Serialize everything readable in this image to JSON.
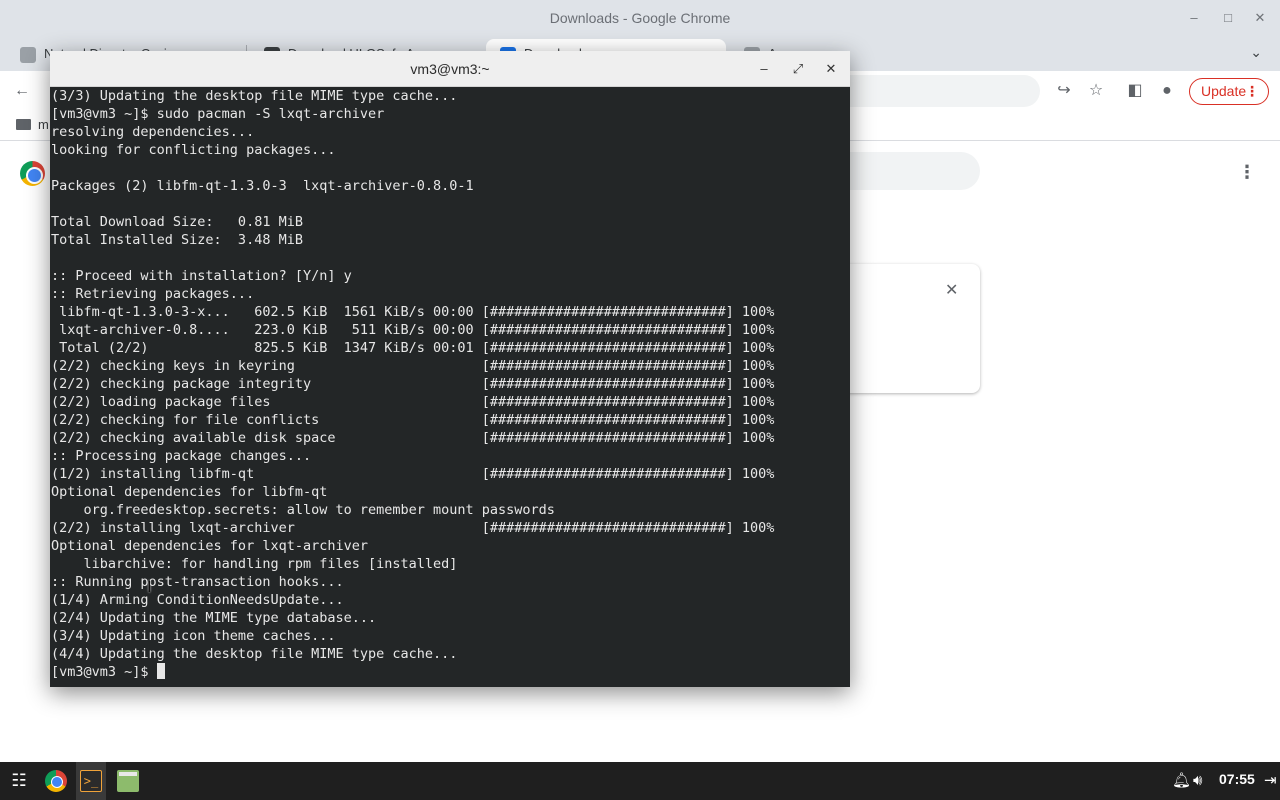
{
  "chrome": {
    "window_title": "Downloads - Google Chrome",
    "tabs": [
      {
        "label": "Natural Disaster Casi..."
      },
      {
        "label": "Download ULGSafe A..."
      },
      {
        "label": "Downloads"
      },
      {
        "label": "A"
      }
    ],
    "update_label": "Update",
    "bookmark_label": "m"
  },
  "terminal": {
    "title": "vm3@vm3:~",
    "lines": [
      "(3/3) Updating the desktop file MIME type cache...",
      "[vm3@vm3 ~]$ sudo pacman -S lxqt-archiver",
      "resolving dependencies...",
      "looking for conflicting packages...",
      "",
      "Packages (2) libfm-qt-1.3.0-3  lxqt-archiver-0.8.0-1",
      "",
      "Total Download Size:   0.81 MiB",
      "Total Installed Size:  3.48 MiB",
      "",
      ":: Proceed with installation? [Y/n] y",
      ":: Retrieving packages...",
      " libfm-qt-1.3.0-3-x...   602.5 KiB  1561 KiB/s 00:00 [#############################] 100%",
      " lxqt-archiver-0.8....   223.0 KiB   511 KiB/s 00:00 [#############################] 100%",
      " Total (2/2)             825.5 KiB  1347 KiB/s 00:01 [#############################] 100%",
      "(2/2) checking keys in keyring                       [#############################] 100%",
      "(2/2) checking package integrity                     [#############################] 100%",
      "(2/2) loading package files                          [#############################] 100%",
      "(2/2) checking for file conflicts                    [#############################] 100%",
      "(2/2) checking available disk space                  [#############################] 100%",
      ":: Processing package changes...",
      "(1/2) installing libfm-qt                            [#############################] 100%",
      "Optional dependencies for libfm-qt",
      "    org.freedesktop.secrets: allow to remember mount passwords",
      "(2/2) installing lxqt-archiver                       [#############################] 100%",
      "Optional dependencies for lxqt-archiver",
      "    libarchive: for handling rpm files [installed]",
      ":: Running post-transaction hooks...",
      "(1/4) Arming ConditionNeedsUpdate...",
      "(2/4) Updating the MIME type database...",
      "(3/4) Updating icon theme caches...",
      "(4/4) Updating the desktop file MIME type cache..."
    ],
    "prompt": "[vm3@vm3 ~]$ "
  },
  "taskbar": {
    "clock": "07:55"
  }
}
